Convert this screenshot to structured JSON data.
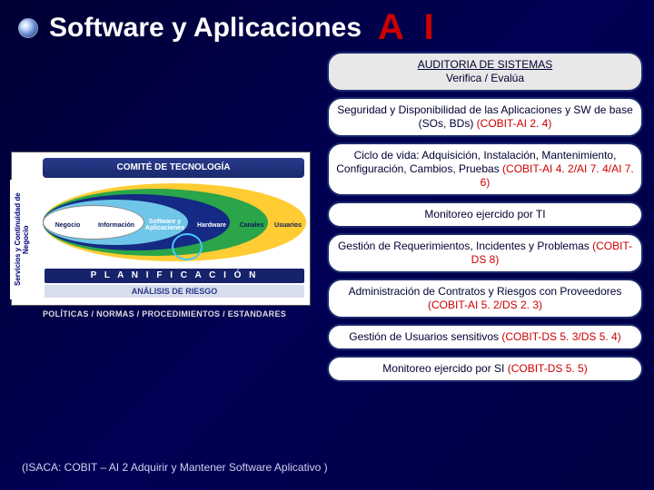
{
  "header": {
    "title": "Software y Aplicaciones",
    "code": "A I"
  },
  "footer": "(ISACA: COBIT – AI 2 Adquirir y Mantener Software Aplicativo )",
  "diagram": {
    "side_label": "Servicios y Continuidad de Negocio",
    "top_bar": "COMITÉ DE TECNOLOGÍA",
    "layers": {
      "l1": "Negocio",
      "l2": "Información",
      "l3": "Software y Aplicaciones",
      "l4": "Hardware",
      "l5": "Canales",
      "l6": "Usuarios"
    },
    "planif": "P L A N I F I C A C I Ó N",
    "riesgo": "ANÁLISIS DE RIESGO",
    "policies": "POLÍTICAS / NORMAS / PROCEDIMIENTOS / ESTANDARES"
  },
  "boxes": {
    "audit": {
      "title": "AUDITORIA DE SISTEMAS",
      "sub": "Verifica / Evalúa"
    },
    "b1": {
      "text": "Seguridad y Disponibilidad de las Aplicaciones y SW de base (SOs, BDs) ",
      "ref": "(COBIT-AI 2. 4)"
    },
    "b2": {
      "text": "Ciclo de vida: Adquisición, Instalación, Mantenimiento, Configuración, Cambios, Pruebas ",
      "ref": "(COBIT-AI 4. 2/AI 7. 4/AI 7. 6)"
    },
    "b3": {
      "text": "Monitoreo ejercido por TI",
      "ref": ""
    },
    "b4": {
      "text": "Gestión de Requerimientos, Incidentes y Problemas ",
      "ref": "(COBIT-DS 8)"
    },
    "b5": {
      "text": "Administración de Contratos y Riesgos con Proveedores ",
      "ref": "(COBIT-AI 5. 2/DS 2. 3)"
    },
    "b6": {
      "text": "Gestión de Usuarios sensitivos ",
      "ref": "(COBIT-DS 5. 3/DS 5. 4)"
    },
    "b7": {
      "text": "Monitoreo ejercido por SI ",
      "ref": "(COBIT-DS 5. 5)"
    }
  }
}
